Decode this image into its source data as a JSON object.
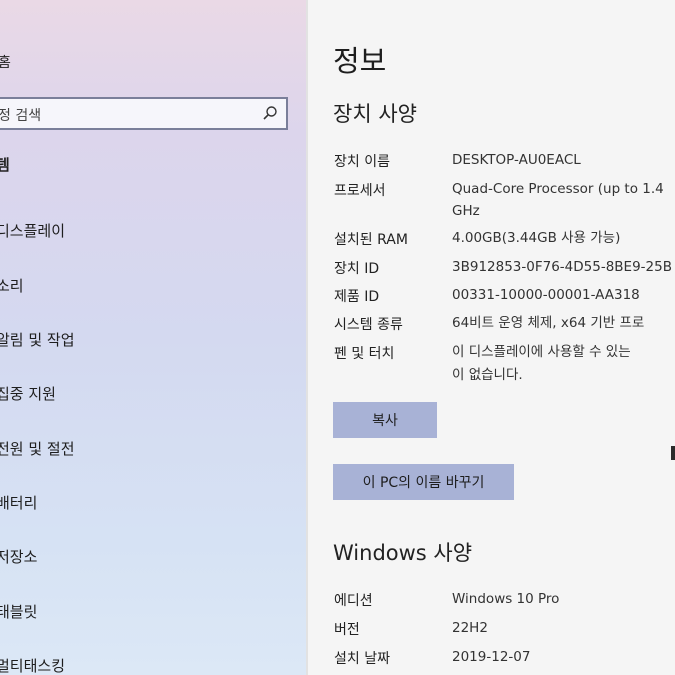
{
  "sidebar": {
    "home_label": "홈",
    "search_placeholder": "정 검색",
    "section_label": "템",
    "items": [
      {
        "label": "디스플레이"
      },
      {
        "label": "소리"
      },
      {
        "label": "알림 및 작업"
      },
      {
        "label": "집중 지원"
      },
      {
        "label": "전원 및 절전"
      },
      {
        "label": "배터리"
      },
      {
        "label": "저장소"
      },
      {
        "label": "태블릿"
      },
      {
        "label": "멀티태스킹"
      }
    ]
  },
  "main": {
    "title": "정보",
    "device_spec": {
      "heading": "장치 사양",
      "rows": [
        {
          "label": "장치 이름",
          "value": "DESKTOP-AU0EACL"
        },
        {
          "label": "프로세서",
          "value": "Quad-Core Processor (up to 1.4",
          "value2": "GHz"
        },
        {
          "label": "설치된 RAM",
          "value": "4.00GB(3.44GB 사용 가능)"
        },
        {
          "label": "장치 ID",
          "value": "3B912853-0F76-4D55-8BE9-25B"
        },
        {
          "label": "제품 ID",
          "value": "00331-10000-00001-AA318"
        },
        {
          "label": "시스템 종류",
          "value": "64비트 운영 체제, x64 기반 프로"
        },
        {
          "label": "펜 및 터치",
          "value": "이 디스플레이에 사용할 수 있는",
          "value2": "이 없습니다."
        }
      ],
      "copy_button": "복사",
      "rename_button": "이 PC의 이름 바꾸기"
    },
    "windows_spec": {
      "heading": "Windows 사양",
      "rows": [
        {
          "label": "에디션",
          "value": "Windows 10 Pro"
        },
        {
          "label": "버전",
          "value": "22H2"
        },
        {
          "label": "설치 날짜",
          "value": "2019-12-07"
        }
      ]
    }
  }
}
